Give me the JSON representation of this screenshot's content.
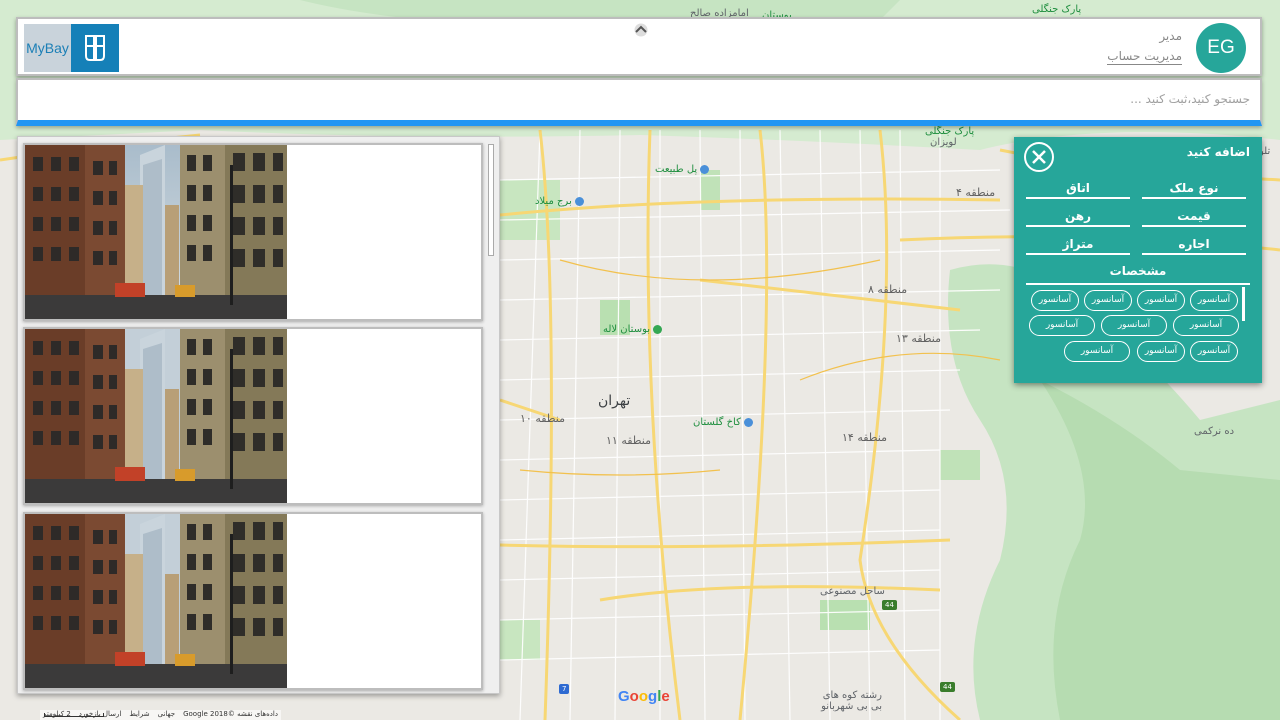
{
  "header": {
    "logo_text": "MyBay",
    "user_initials": "EG",
    "user_role": "مدیر",
    "manage_account_link": "مدیریت حساب"
  },
  "search": {
    "placeholder": "جستجو کنید،ثبت کنید ..."
  },
  "listings": [
    {
      "image": "city-street-photo"
    },
    {
      "image": "city-street-photo"
    },
    {
      "image": "city-street-photo"
    }
  ],
  "filter_panel": {
    "title": "اضافه کنید",
    "fields": {
      "property_type": "نوع ملک",
      "room": "اتاق",
      "price": "قیمت",
      "mortgage": "رهن",
      "rent": "اجاره",
      "area": "متراژ"
    },
    "features_label": "مشخصات",
    "chips": [
      "آسانسور",
      "آسانسور",
      "آسانسور",
      "آسانسور",
      "آسانسور",
      "آسانسور",
      "آسانسور",
      "آسانسور",
      "آسانسور",
      "آسانسور"
    ]
  },
  "map": {
    "labels": {
      "tehran": "تهران",
      "district_4": "منطقه ۴",
      "district_8": "منطقه ۸",
      "district_13": "منطقه ۱۳",
      "district_14": "منطقه ۱۴",
      "district_10": "منطقه ۱۰",
      "district_11": "منطقه ۱۱",
      "park_laleh": "بوستان لاله",
      "golestan_palace": "کاخ گلستان",
      "pol_tabiat": "پل طبیعت",
      "milad_tower": "برج میلاد",
      "park_jangali": "پارک جنگلی",
      "lavizan": "لویزان",
      "deh_narkami": "ده نرکمی",
      "sahel_masnoei": "ساحل مصنوعی",
      "bibi_shahrbanu": "رشته کوه های بی بی شهربانو",
      "imamzadeh_saleh": "امامزاده صالح",
      "bustan": "بوستان",
      "park_jangali_top": "پارک جنگلی",
      "talu_park": "تلو پا"
    },
    "highways": [
      "44",
      "44",
      "7"
    ],
    "footer": {
      "data": "داده‌های نقشه ©2018 Google",
      "global": "جهانی",
      "terms": "شرایط",
      "report": "ارسال بازخورد",
      "scale": "2 کیلومتر"
    },
    "google_logo": [
      "G",
      "o",
      "o",
      "g",
      "l",
      "e"
    ]
  }
}
